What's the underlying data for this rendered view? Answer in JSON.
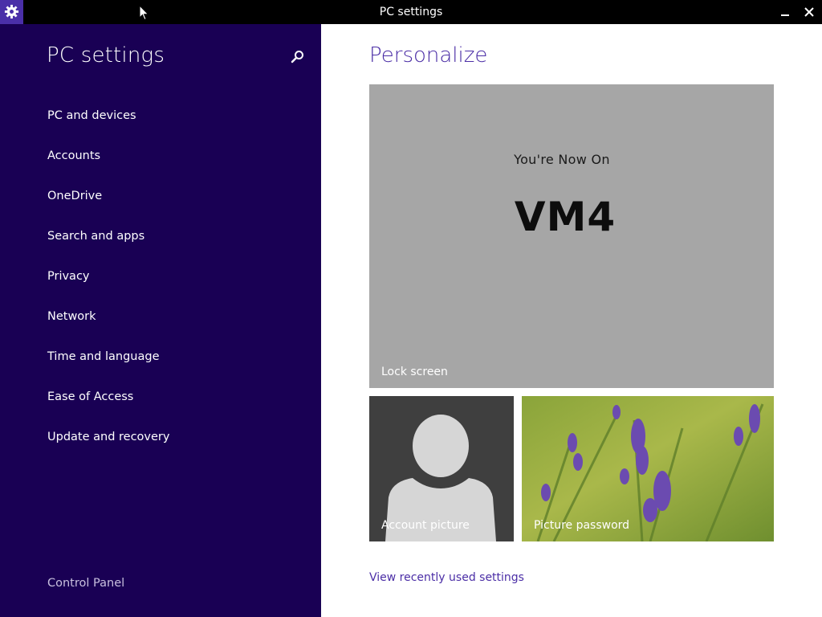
{
  "window": {
    "title": "PC settings",
    "minimize_glyph": "–",
    "close_glyph": "✕"
  },
  "nav": {
    "title": "PC settings",
    "items": [
      {
        "label": "PC and devices"
      },
      {
        "label": "Accounts"
      },
      {
        "label": "OneDrive"
      },
      {
        "label": "Search and apps"
      },
      {
        "label": "Privacy"
      },
      {
        "label": "Network"
      },
      {
        "label": "Time and language"
      },
      {
        "label": "Ease of Access"
      },
      {
        "label": "Update and recovery"
      }
    ],
    "footer": "Control Panel"
  },
  "content": {
    "title": "Personalize",
    "lock_screen": {
      "line1": "You're Now On",
      "line2": "VM4",
      "label": "Lock screen"
    },
    "account_picture": {
      "label": "Account picture"
    },
    "picture_password": {
      "label": "Picture password"
    },
    "link": "View recently used settings"
  },
  "colors": {
    "nav_background": "#190054",
    "accent": "#4b2ea6",
    "lock_tile": "#a6a6a6",
    "account_tile": "#3f3f3f"
  },
  "icons": [
    "gear-icon",
    "search-icon",
    "minimize-icon",
    "close-icon",
    "mouse-cursor-icon",
    "person-silhouette-icon"
  ]
}
